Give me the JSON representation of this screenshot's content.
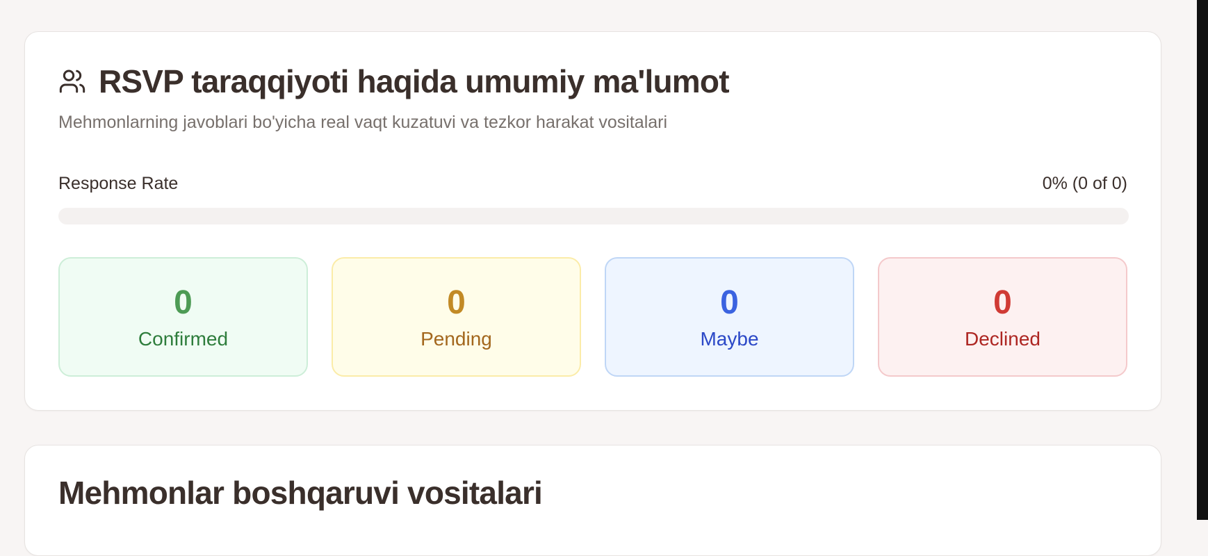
{
  "rsvp_overview": {
    "icon": "users-icon",
    "title": "RSVP taraqqiyoti haqida umumiy ma'lumot",
    "subtitle": "Mehmonlarning javoblari bo'yicha real vaqt kuzatuvi va tezkor harakat vositalari",
    "response_rate": {
      "label": "Response Rate",
      "value_text": "0% (0 of 0)",
      "percent": 0
    },
    "stats": [
      {
        "value": "0",
        "label": "Confirmed",
        "color": "#4d9b55"
      },
      {
        "value": "0",
        "label": "Pending",
        "color": "#c28a25"
      },
      {
        "value": "0",
        "label": "Maybe",
        "color": "#3b63e0"
      },
      {
        "value": "0",
        "label": "Declined",
        "color": "#d03b35"
      }
    ]
  },
  "guest_management": {
    "title": "Mehmonlar boshqaruvi vositalari"
  }
}
